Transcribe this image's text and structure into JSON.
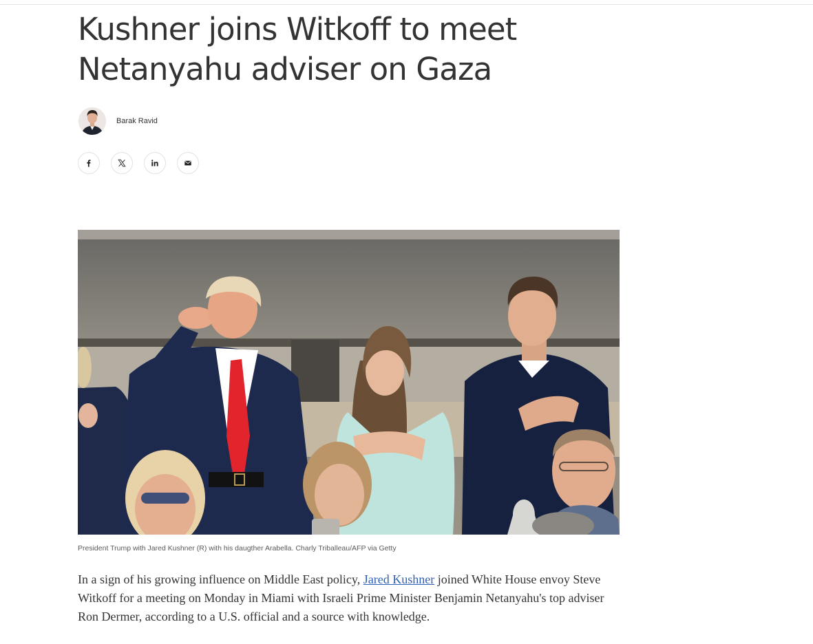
{
  "article": {
    "headline": "Kushner joins Witkoff to meet Netanyahu adviser on Gaza",
    "author": {
      "name": "Barak Ravid",
      "avatar_icon": "author-portrait"
    },
    "share_buttons": [
      {
        "network": "facebook",
        "icon": "facebook-icon"
      },
      {
        "network": "x",
        "icon": "x-icon"
      },
      {
        "network": "linkedin",
        "icon": "linkedin-icon"
      },
      {
        "network": "email",
        "icon": "mail-icon"
      }
    ],
    "image": {
      "caption": "President Trump with Jared Kushner (R) with his daugther Arabella. Charly Triballeau/AFP via Getty"
    },
    "lead": {
      "before_link": "In a sign of his growing influence on Middle East policy, ",
      "link_text": "Jared Kushner",
      "after_link": " joined White House envoy Steve Witkoff for a meeting on Monday in Miami with Israeli Prime Minister Benjamin Netanyahu's top adviser Ron Dermer, according to a U.S. official and a source with knowledge."
    }
  },
  "colors": {
    "text": "#333333",
    "link": "#2f5fb3",
    "caption": "#5a5a5a",
    "border": "#e2e2e2"
  }
}
